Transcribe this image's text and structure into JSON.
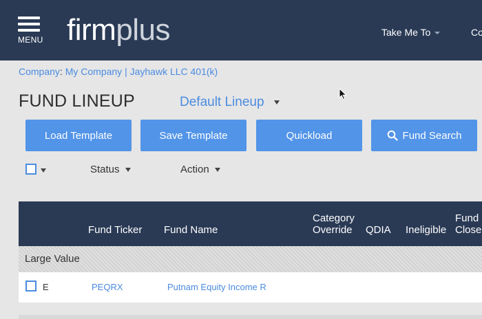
{
  "header": {
    "menu_label": "MENU",
    "logo_a": "firm",
    "logo_b": "plus",
    "take_me_to": "Take Me To",
    "next_nav_partial": "Co"
  },
  "breadcrumb": {
    "prefix": "Company",
    "colon": ":",
    "company": "My Company",
    "separator": "|",
    "plan": "Jayhawk LLC 401(k)"
  },
  "page": {
    "title": "FUND LINEUP",
    "lineup_selected": "Default Lineup"
  },
  "toolbar": {
    "load_template": "Load Template",
    "save_template": "Save Template",
    "quickload": "Quickload",
    "fund_search": "Fund Search"
  },
  "filters": {
    "status": "Status",
    "action": "Action"
  },
  "table": {
    "columns": {
      "ticker": "Fund Ticker",
      "name": "Fund Name",
      "category_override_1": "Category",
      "category_override_2": "Override",
      "qdia": "QDIA",
      "ineligible": "Ineligible",
      "fund_closed_1": "Fund",
      "fund_closed_2": "Closed"
    },
    "groups": [
      {
        "label": "Large Value",
        "rows": [
          {
            "flag": "E",
            "ticker": "PEQRX",
            "name": "Putnam Equity Income R"
          }
        ]
      }
    ]
  },
  "colors": {
    "navbar": "#2a3a55",
    "accent": "#5294e8",
    "link": "#4a8be0",
    "background": "#e6e6e6"
  },
  "icons": [
    "menu-icon",
    "search-icon",
    "chevron-down-icon",
    "mouse-cursor-icon"
  ]
}
